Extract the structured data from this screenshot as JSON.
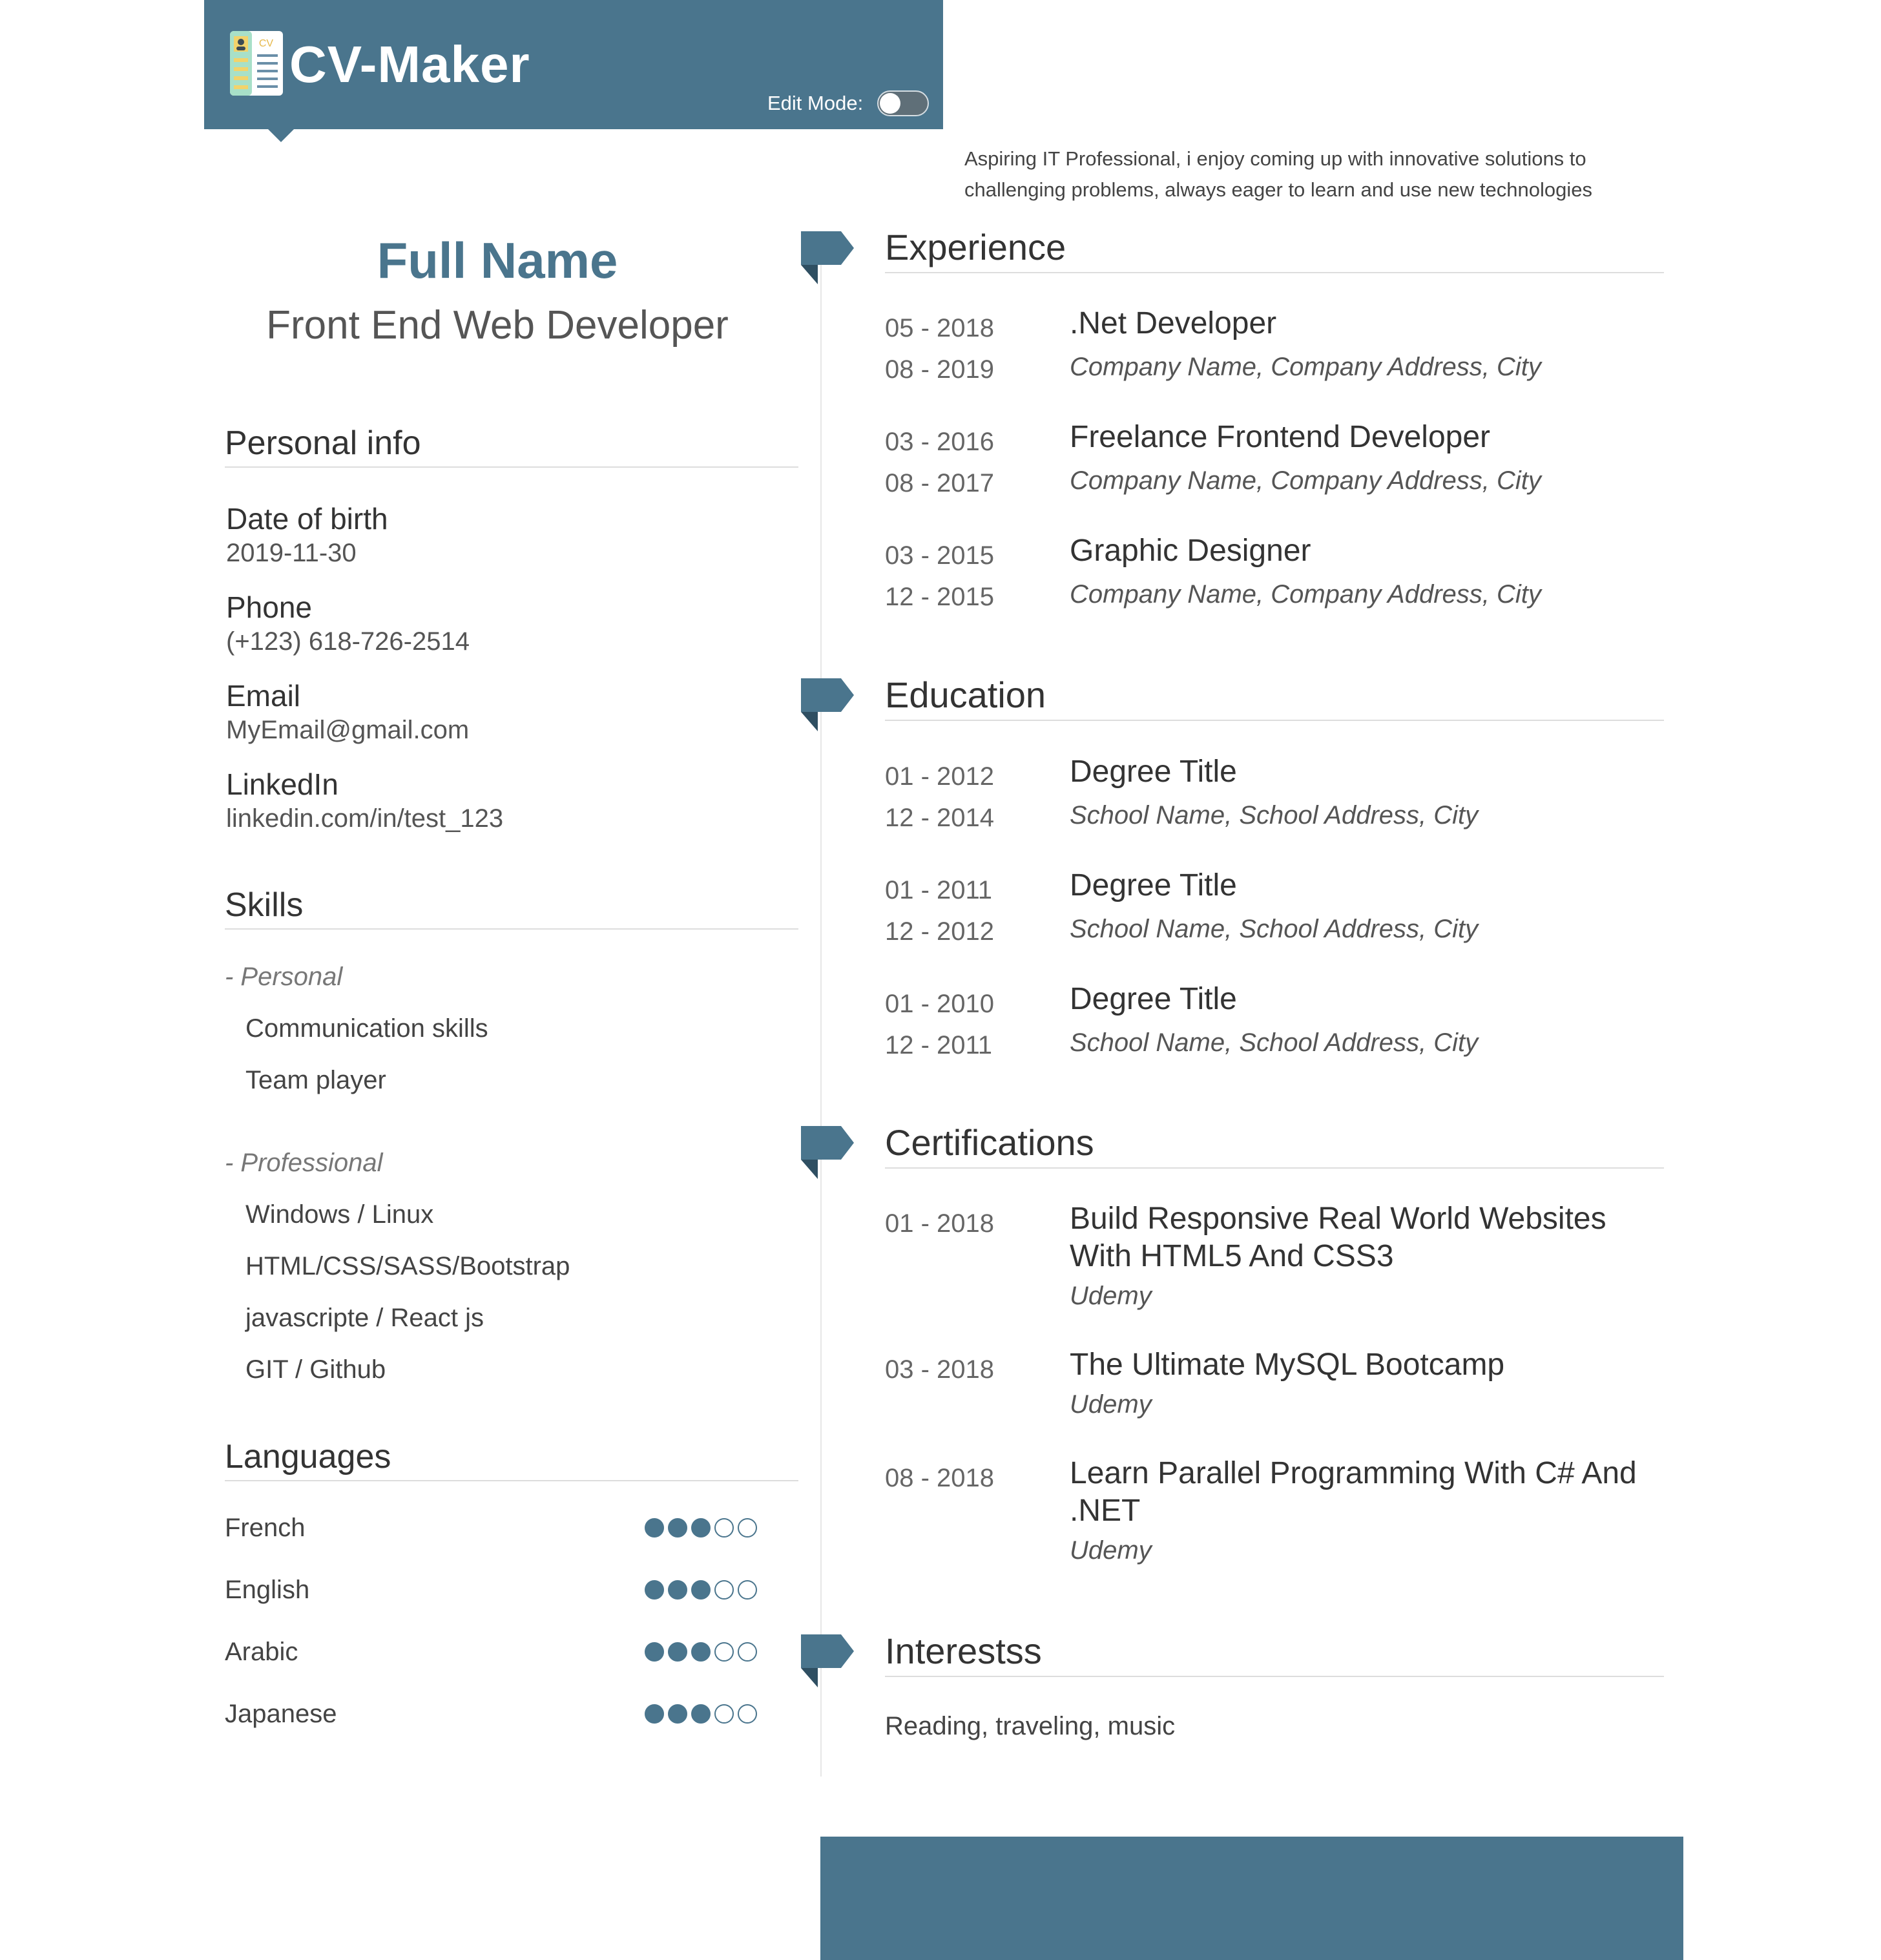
{
  "header": {
    "app_title": "CV-Maker",
    "logo_icon": "cv-document-icon",
    "edit_mode_label": "Edit Mode:",
    "edit_mode_on": false,
    "accent_color": "#4a758d"
  },
  "summary": "Aspiring IT Professional, i enjoy coming up with innovative solutions to challenging problems, always eager to learn and use new technologies",
  "profile": {
    "full_name": "Full Name",
    "job_title": "Front End Web Developer"
  },
  "personal_info": {
    "heading": "Personal info",
    "items": [
      {
        "label": "Date of birth",
        "value": "2019-11-30"
      },
      {
        "label": "Phone",
        "value": "(+123) 618-726-2514"
      },
      {
        "label": "Email",
        "value": "MyEmail@gmail.com"
      },
      {
        "label": "LinkedIn",
        "value": "linkedin.com/in/test_123"
      }
    ]
  },
  "skills": {
    "heading": "Skills",
    "categories": [
      {
        "name": "- Personal",
        "items": [
          "Communication skills",
          "Team player"
        ]
      },
      {
        "name": "- Professional",
        "items": [
          "Windows / Linux",
          "HTML/CSS/SASS/Bootstrap",
          "javascripte / React js",
          "GIT / Github"
        ]
      }
    ]
  },
  "languages": {
    "heading": "Languages",
    "items": [
      {
        "name": "French",
        "level": 3,
        "max": 5
      },
      {
        "name": "English",
        "level": 3,
        "max": 5
      },
      {
        "name": "Arabic",
        "level": 3,
        "max": 5
      },
      {
        "name": "Japanese",
        "level": 3,
        "max": 5
      }
    ]
  },
  "experience": {
    "heading": "Experience",
    "items": [
      {
        "start": "05 - 2018",
        "end": "08 - 2019",
        "title": ".Net Developer",
        "sub": "Company Name, Company Address, City"
      },
      {
        "start": "03 - 2016",
        "end": "08 - 2017",
        "title": "Freelance Frontend Developer",
        "sub": "Company Name, Company Address, City"
      },
      {
        "start": "03 - 2015",
        "end": "12 - 2015",
        "title": "Graphic Designer",
        "sub": "Company Name, Company Address, City"
      }
    ]
  },
  "education": {
    "heading": "Education",
    "items": [
      {
        "start": "01 - 2012",
        "end": "12 - 2014",
        "title": "Degree Title",
        "sub": "School Name, School Address, City"
      },
      {
        "start": "01 - 2011",
        "end": "12 - 2012",
        "title": "Degree Title",
        "sub": "School Name, School Address, City"
      },
      {
        "start": "01 - 2010",
        "end": "12 - 2011",
        "title": "Degree Title",
        "sub": "School Name, School Address, City"
      }
    ]
  },
  "certifications": {
    "heading": "Certifications",
    "items": [
      {
        "date": "01 - 2018",
        "title": "Build Responsive Real World Websites With HTML5 And CSS3",
        "sub": "Udemy"
      },
      {
        "date": "03 - 2018",
        "title": "The Ultimate MySQL Bootcamp",
        "sub": "Udemy"
      },
      {
        "date": "08 - 2018",
        "title": "Learn Parallel Programming With C# And .NET",
        "sub": "Udemy"
      }
    ]
  },
  "interests": {
    "heading": "Interestss",
    "text": "Reading, traveling, music"
  }
}
